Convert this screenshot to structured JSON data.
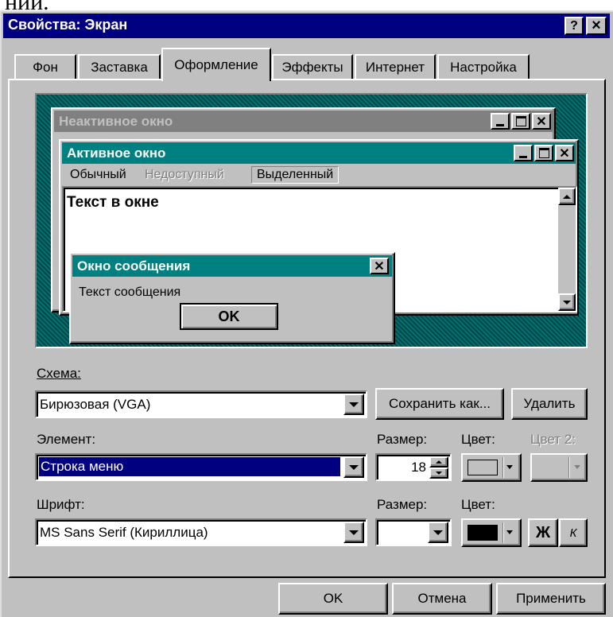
{
  "window": {
    "title": "Свойства: Экран",
    "title_bg": "#000080",
    "help_btn": "?",
    "close_btn": "×"
  },
  "tabs": [
    {
      "label": "Фон",
      "active": false
    },
    {
      "label": "Заставка",
      "active": false
    },
    {
      "label": "Оформление",
      "active": true
    },
    {
      "label": "Эффекты",
      "active": false
    },
    {
      "label": "Интернет",
      "active": false
    },
    {
      "label": "Настройка",
      "active": false
    }
  ],
  "preview": {
    "desktop_color": "#008080",
    "inactive_title": "Неактивное окно",
    "active_title": "Активное окно",
    "menu_normal": "Обычный",
    "menu_disabled": "Недоступный",
    "menu_selected": "Выделенный",
    "window_text": "Текст в окне",
    "msg_title": "Окно сообщения",
    "msg_text": "Текст сообщения",
    "msg_ok": "OK"
  },
  "scheme": {
    "label": "Схема:",
    "value": "Бирюзовая (VGA)",
    "save_as": "Сохранить как...",
    "delete": "Удалить"
  },
  "element": {
    "label": "Элемент:",
    "value": "Строка меню",
    "size_label": "Размер:",
    "size_value": "18",
    "color_label": "Цвет:",
    "color2_label": "Цвет 2:"
  },
  "font": {
    "label": "Шрифт:",
    "value": "MS Sans Serif (Кириллица)",
    "size_label": "Размер:",
    "color_label": "Цвет:",
    "bold": "Ж",
    "italic": "К"
  },
  "buttons": {
    "ok": "OK",
    "cancel": "Отмена",
    "apply": "Применить"
  },
  "heading_fragment": "ний."
}
